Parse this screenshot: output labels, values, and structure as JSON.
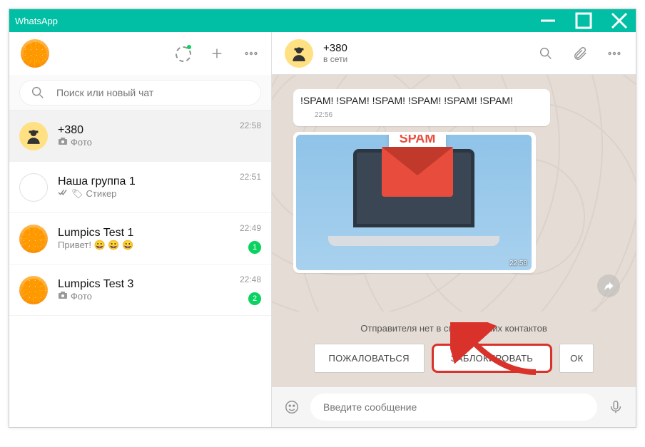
{
  "window": {
    "title": "WhatsApp"
  },
  "sidebar": {
    "search_placeholder": "Поиск или новый чат",
    "chats": [
      {
        "name": "+380",
        "preview": "Фото",
        "time": "22:58",
        "has_photo_icon": true,
        "unread": null
      },
      {
        "name": "Наша группа 1",
        "preview": "Стикер",
        "time": "22:51",
        "has_checks": true,
        "unread": null
      },
      {
        "name": "Lumpics Test 1",
        "preview": "Привет! 😀 😀 😀",
        "time": "22:49",
        "unread": "1"
      },
      {
        "name": "Lumpics Test 3",
        "preview": "Фото",
        "time": "22:48",
        "has_photo_icon": true,
        "unread": "2"
      }
    ]
  },
  "chat": {
    "contact_name": "+380",
    "contact_status": "в сети",
    "message_text": "!SPAM! !SPAM! !SPAM! !SPAM! !SPAM! !SPAM!",
    "message_time": "22:56",
    "image_label": "SPAM",
    "image_time": "22:58"
  },
  "banner": {
    "text": "Отправителя нет в списке ваших контактов",
    "report": "ПОЖАЛОВАТЬСЯ",
    "block": "ЗАБЛОКИРОВАТЬ",
    "ok": "ОК"
  },
  "composer": {
    "placeholder": "Введите сообщение"
  }
}
